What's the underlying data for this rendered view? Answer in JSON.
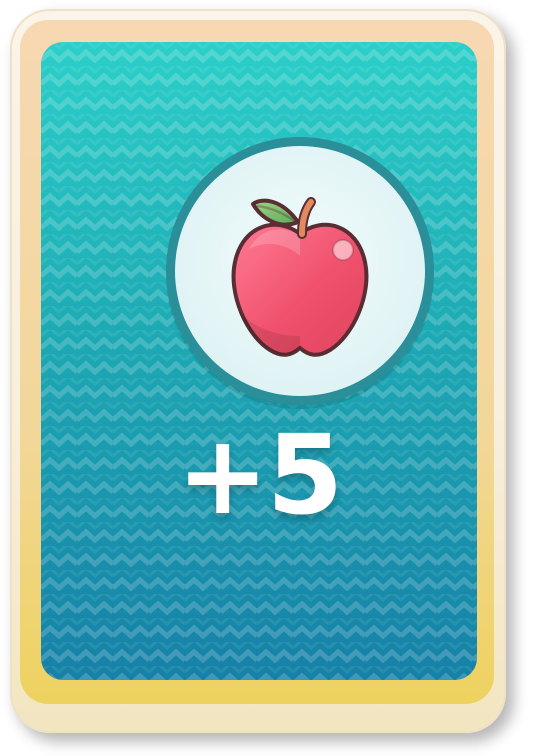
{
  "card": {
    "reward_amount": "+5",
    "reward_icon": "apple-icon"
  },
  "colors": {
    "frame": "#fbf4e8",
    "trim_top": "#f7d8b3",
    "trim_bottom": "#eed25f",
    "face_top": "#2ccfc9",
    "face_bottom": "#1681a7",
    "badge_ring": "#2a8f99",
    "badge_fill": "#e6f6f7",
    "apple_red": "#f0516c",
    "apple_leaf": "#7fbe6d",
    "apple_stem": "#e28a5f",
    "text": "#ffffff"
  }
}
